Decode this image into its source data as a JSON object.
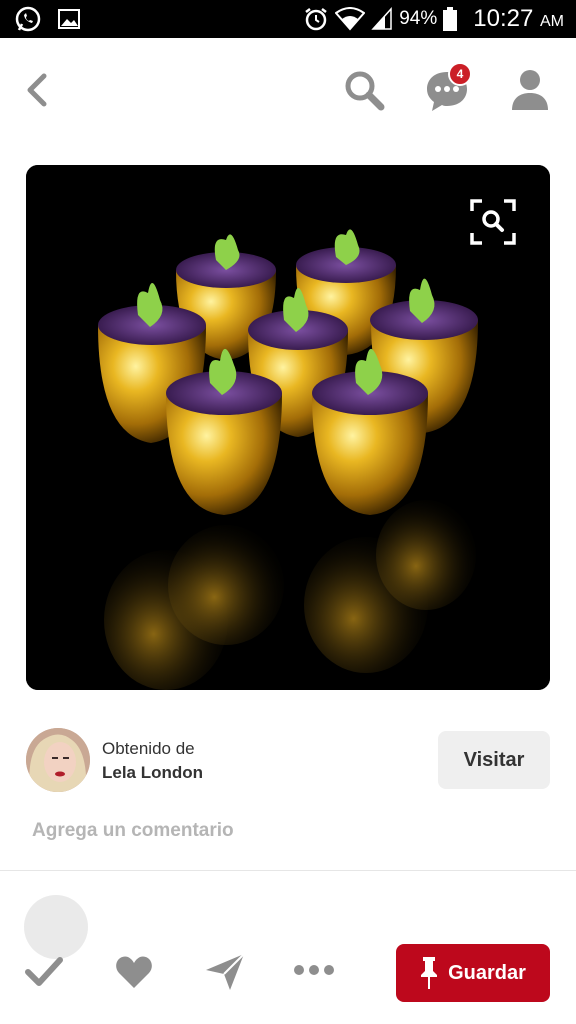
{
  "status_bar": {
    "battery_percent": "94%",
    "time": "10:27",
    "ampm": "AM",
    "icons": [
      "whatsapp-icon",
      "gallery-icon",
      "alarm-icon",
      "wifi-icon",
      "signal-icon",
      "battery-icon"
    ]
  },
  "nav": {
    "notifications_count": "4",
    "icons": [
      "back-icon",
      "search-icon",
      "chat-icon",
      "profile-icon"
    ]
  },
  "pin": {
    "image_subject": "golden eggs with caviar and sprouts",
    "visual_search_icon": "visual-search-icon"
  },
  "source": {
    "label": "Obtenido de",
    "name": "Lela London",
    "visit_label": "Visitar"
  },
  "comment": {
    "placeholder": "Agrega un comentario"
  },
  "actions": {
    "save_label": "Guardar",
    "icons": [
      "check-icon",
      "heart-icon",
      "send-icon",
      "more-icon",
      "pin-icon"
    ]
  },
  "colors": {
    "accent": "#bd081c",
    "badge": "#cb1f27",
    "icon_gray": "#8e8e8e"
  }
}
